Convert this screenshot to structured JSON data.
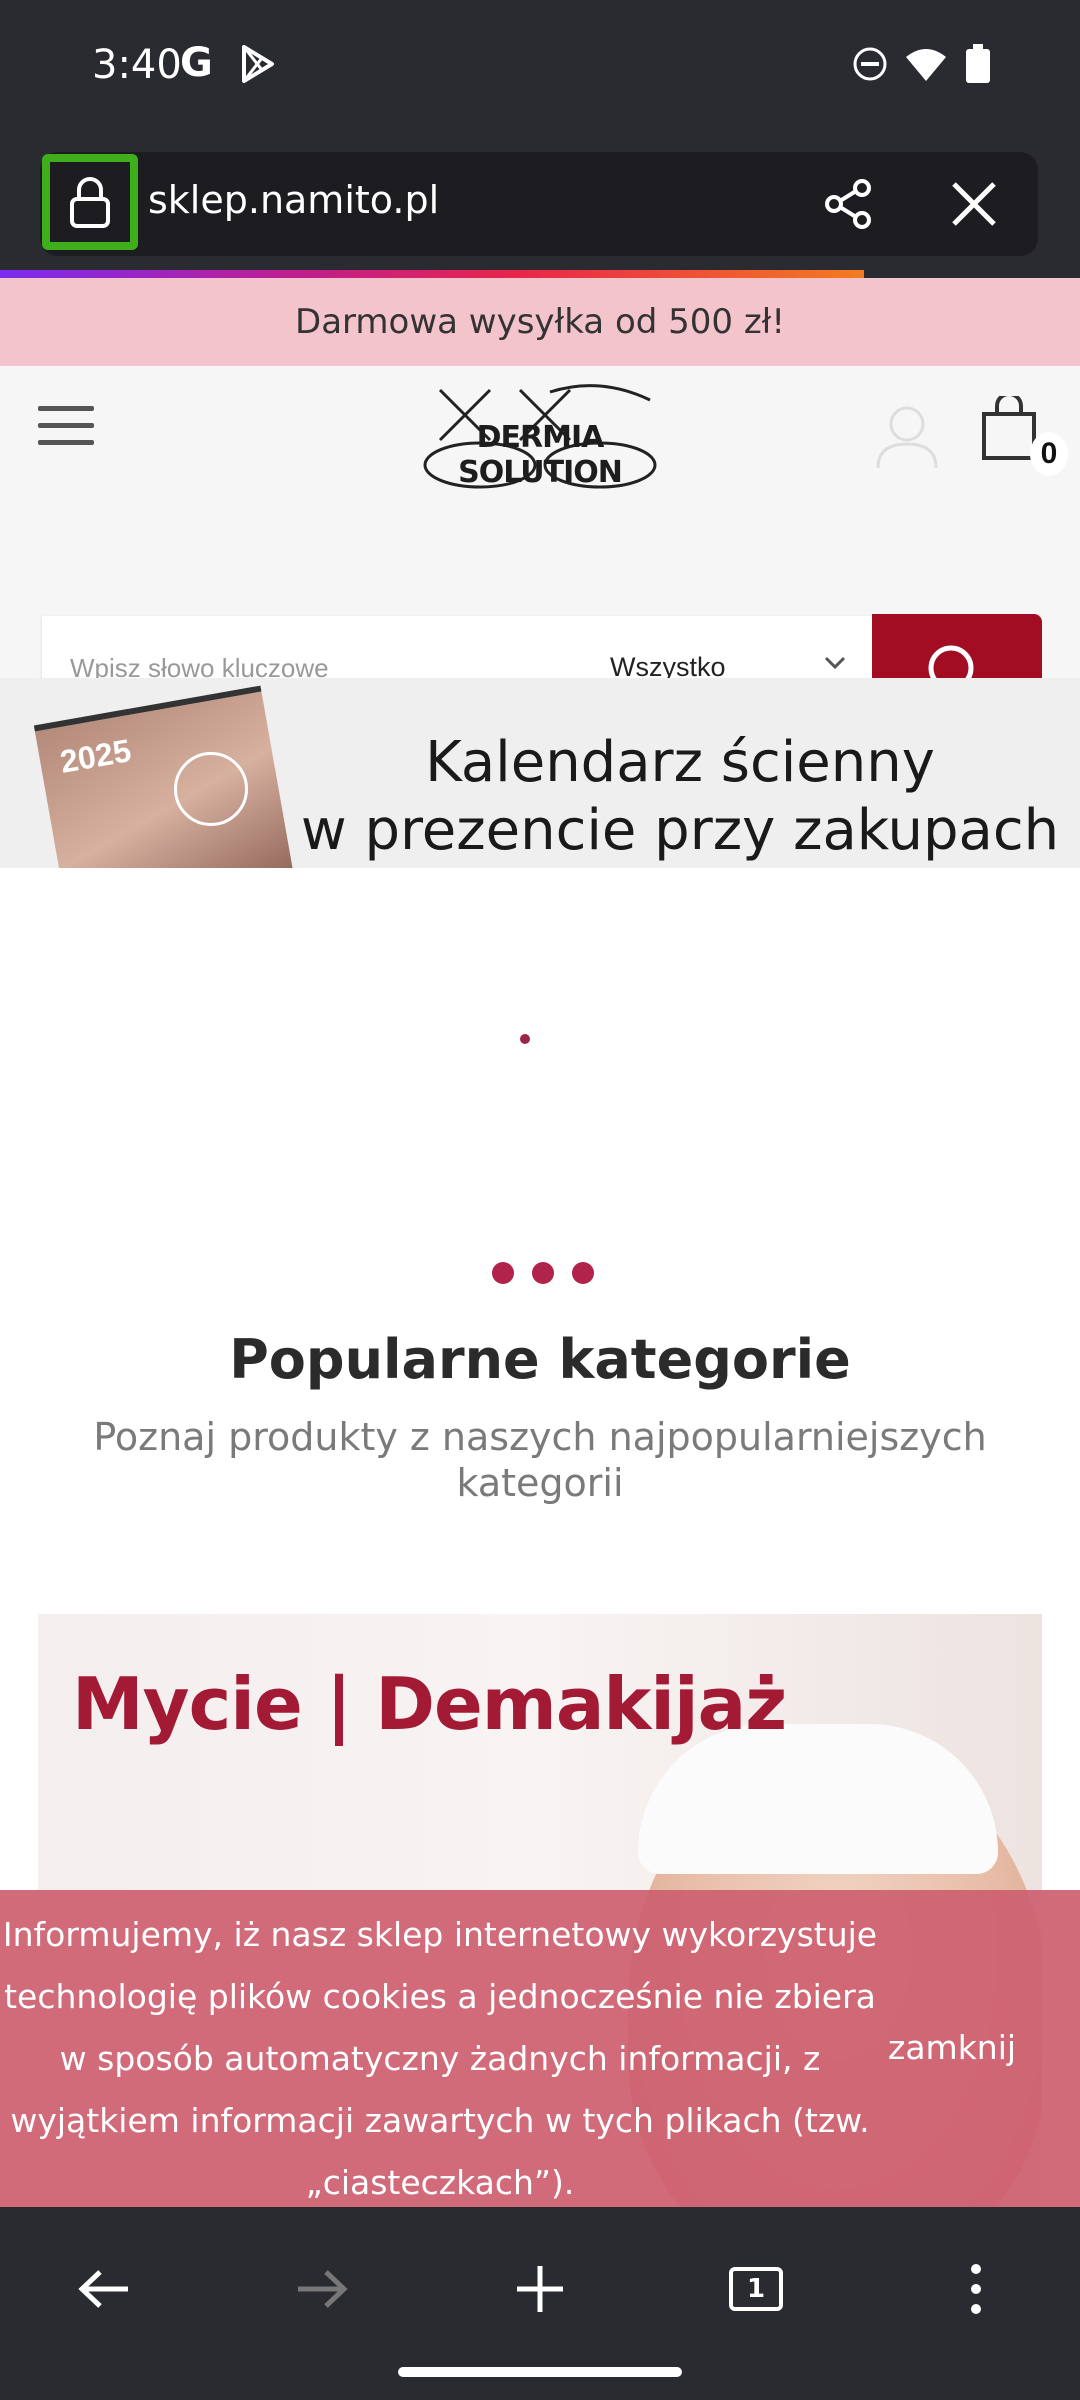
{
  "status_bar": {
    "time": "3:40",
    "g_label": "G"
  },
  "browser": {
    "url": "sklep.namito.pl",
    "tab_count": "1"
  },
  "promo": {
    "text": "Darmowa wysyłka od 500 zł!"
  },
  "header": {
    "logo_text": "DERMIA SOLUTION",
    "cart_count": "0"
  },
  "search": {
    "placeholder": "Wpisz słowo kluczowe",
    "category": "Wszystko"
  },
  "banner": {
    "calendar_year": "2025",
    "line1": "Kalendarz ścienny",
    "line2": "w prezencie przy zakupach"
  },
  "categories_section": {
    "title": "Popularne kategorie",
    "subtitle": "Poznaj produkty z naszych najpopularniejszych kategorii",
    "card_title": "Mycie | Demakijaż"
  },
  "cookie": {
    "lines": [
      "Informujemy, iż nasz sklep internetowy wykorzystuje",
      "technologię plików cookies a jednocześnie nie zbiera",
      "w sposób automatyczny żadnych informacji, z",
      "wyjątkiem informacji zawartych w tych plikach (tzw.",
      "„ciasteczkach”)."
    ],
    "close_label": "zamknij"
  },
  "colors": {
    "accent": "#a30d24",
    "lock_highlight": "#3fae1c",
    "promo_bg": "#f4c4cc",
    "cookie_bg": "#cd6070"
  }
}
